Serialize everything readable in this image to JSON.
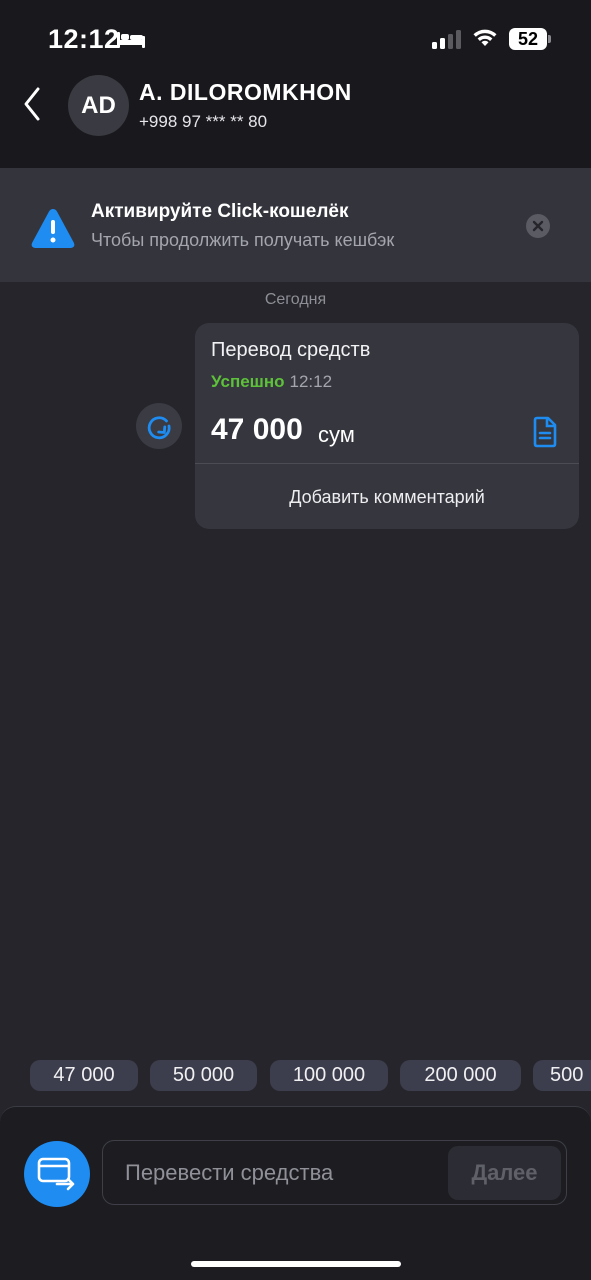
{
  "status_bar": {
    "time": "12:12",
    "battery": "52"
  },
  "header": {
    "avatar_initials": "AD",
    "name": "A. DILOROMKHON",
    "phone": "+998 97 *** ** 80"
  },
  "banner": {
    "title": "Активируйте Click-кошелёк",
    "subtitle": "Чтобы продолжить получать кешбэк"
  },
  "chat": {
    "date_label": "Сегодня",
    "transfer_card": {
      "title": "Перевод средств",
      "status": "Успешно",
      "time": "12:12",
      "amount": "47 000",
      "currency": "сум",
      "comment_button": "Добавить комментарий"
    }
  },
  "quick_amounts": [
    "47 000",
    "50 000",
    "100 000",
    "200 000",
    "500"
  ],
  "bottom": {
    "input_placeholder": "Перевести средства",
    "next_button": "Далее"
  },
  "colors": {
    "accent": "#1e8cf0",
    "success": "#5ec13a",
    "background": "#25252b"
  }
}
